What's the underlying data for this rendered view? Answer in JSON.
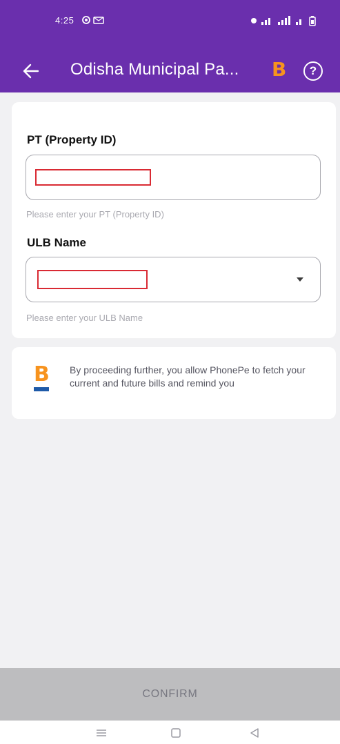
{
  "status_bar": {
    "time": "4:25",
    "left_icons": [
      "sync-icon",
      "mail-icon"
    ],
    "right_icons": [
      "location-icon",
      "signal-icon",
      "signal-icon",
      "battery-icon"
    ]
  },
  "app_bar": {
    "title": "Odisha Municipal Pa...",
    "logo_letter": "B",
    "help_glyph": "?"
  },
  "form": {
    "property_label": "PT (Property ID)",
    "property_helper": "Please enter your PT (Property ID)",
    "ulb_label": "ULB Name",
    "ulb_helper": "Please enter your ULB Name"
  },
  "consent": {
    "logo_letter": "B",
    "text": "By proceeding further, you allow PhonePe to fetch your current and future bills and remind you"
  },
  "footer": {
    "confirm_label": "CONFIRM"
  },
  "colors": {
    "brand_purple": "#6a2fad",
    "bbps_orange": "#f7931e",
    "confirm_disabled": "#bdbdbf"
  }
}
